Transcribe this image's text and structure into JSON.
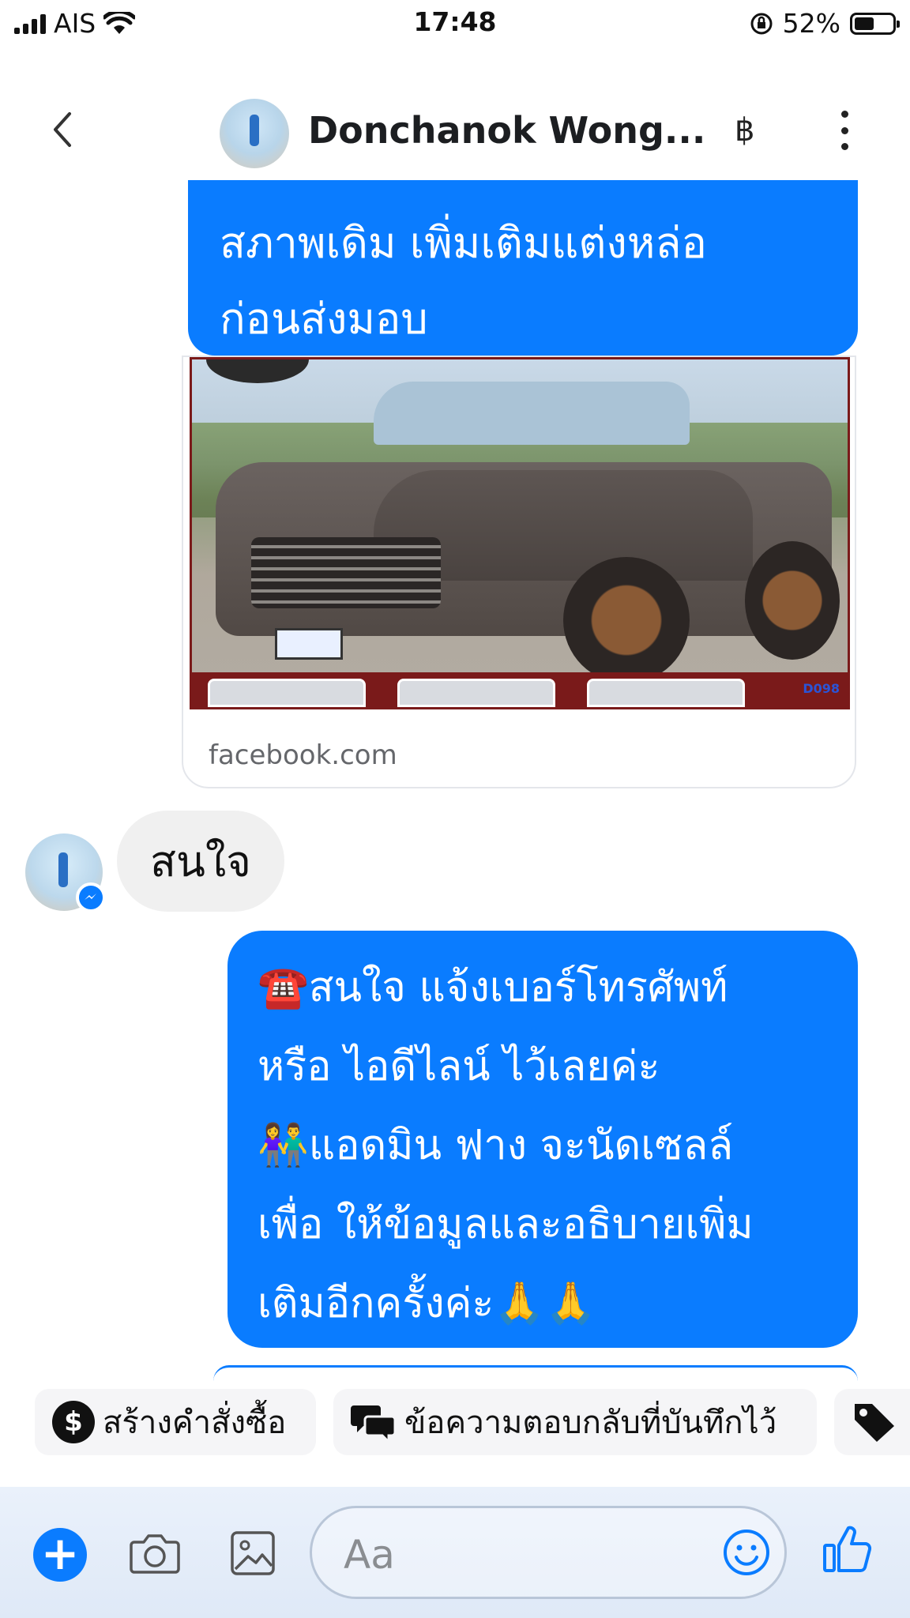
{
  "status_bar": {
    "carrier": "AIS",
    "time": "17:48",
    "battery": "52%",
    "battery_level": 0.52
  },
  "header": {
    "contact_name": "Donchanok Wong...",
    "currency_symbol": "฿"
  },
  "messages": {
    "outgoing_top": "สภาพเดิม เพิ่มเติมแต่งหล่อ\nก่อนส่งมอบ",
    "link_card": {
      "domain": "facebook.com",
      "image_badge": "D098"
    },
    "incoming": "สนใจ",
    "outgoing_main": "☎️สนใจ แจ้งเบอร์โทรศัพท์\nหรือ ไอดีไลน์  ไว้เลยค่ะ\n👫แอดมิน ฟาง จะนัดเซลล์\nเพื่อ ให้ข้อมูลและอธิบายเพิ่ม\nเติมอีกครั้งค่ะ🙏🙏"
  },
  "quick_actions": [
    {
      "label": "สร้างคำสั่งซื้อ",
      "icon": "dollar-icon"
    },
    {
      "label": "ข้อความตอบกลับที่บันทึกไว้",
      "icon": "chat-bubbles-icon"
    },
    {
      "label": "",
      "icon": "tag-icon"
    }
  ],
  "composer": {
    "placeholder": "Aa"
  },
  "colors": {
    "accent": "#0a7cff",
    "incoming_bubble": "#f0f0f0",
    "text_secondary": "#65676b"
  }
}
